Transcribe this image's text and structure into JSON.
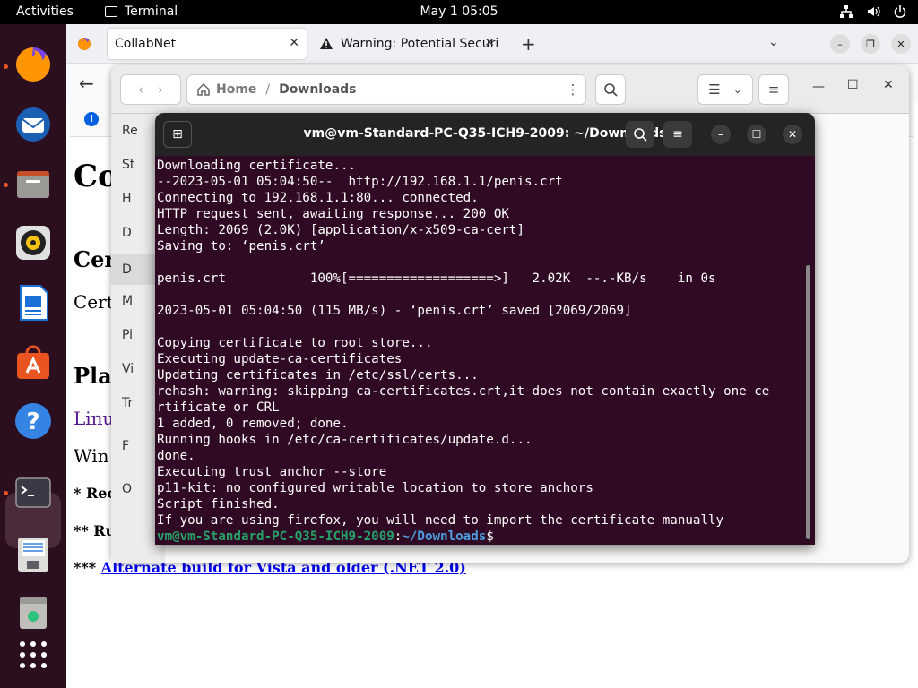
{
  "topbar": {
    "activities": "Activities",
    "app": "Terminal",
    "clock": "May 1  05:05",
    "icons": [
      "network-icon",
      "volume-icon",
      "power-icon"
    ]
  },
  "dock": {
    "apps": [
      "firefox-icon",
      "thunderbird-icon",
      "files-icon",
      "rhythmbox-icon",
      "writer-icon",
      "app-center-icon",
      "help-icon",
      "terminal-icon",
      "text-editor-icon",
      "trash-icon",
      "show-apps-icon"
    ]
  },
  "browser": {
    "tabs": [
      {
        "label": "CollabNet"
      },
      {
        "label": "Warning: Potential Securi"
      }
    ],
    "page": {
      "heading1": "Co",
      "heading2": "Cer",
      "link1": "Cert",
      "heading3": "Pla",
      "link2": "Linu",
      "link3": "Win",
      "note1": "* Rec",
      "note2": "** Ru",
      "note3_prefix": "*** ",
      "note3_link": "Alternate build for Vista and older (.NET 2.0)"
    }
  },
  "files": {
    "breadcrumb": {
      "home": "Home",
      "separator": "/",
      "current": "Downloads"
    },
    "sidebar": [
      "Re",
      "St",
      "H",
      "D",
      "D",
      "M",
      "Pi",
      "Vi",
      "Tr",
      "F",
      "O"
    ]
  },
  "terminal": {
    "title": "vm@vm-Standard-PC-Q35-ICH9-2009: ~/Downloads",
    "lines": [
      "Downloading certificate...",
      "--2023-05-01 05:04:50--  http://192.168.1.1/penis.crt",
      "Connecting to 192.168.1.1:80... connected.",
      "HTTP request sent, awaiting response... 200 OK",
      "Length: 2069 (2.0K) [application/x-x509-ca-cert]",
      "Saving to: ‘penis.crt’",
      "",
      "penis.crt           100%[===================>]   2.02K  --.-KB/s    in 0s",
      "",
      "2023-05-01 05:04:50 (115 MB/s) - ‘penis.crt’ saved [2069/2069]",
      "",
      "Copying certificate to root store...",
      "Executing update-ca-certificates",
      "Updating certificates in /etc/ssl/certs...",
      "rehash: warning: skipping ca-certificates.crt,it does not contain exactly one ce",
      "rtificate or CRL",
      "1 added, 0 removed; done.",
      "Running hooks in /etc/ca-certificates/update.d...",
      "done.",
      "Executing trust anchor --store",
      "p11-kit: no configured writable location to store anchors",
      "Script finished.",
      "If you are using firefox, you will need to import the certificate manually"
    ],
    "prompt_user": "vm@vm-Standard-PC-Q35-ICH9-2009",
    "prompt_sep": ":",
    "prompt_path": "~/Downloads",
    "prompt_end": "$"
  },
  "colors": {
    "terminal_bg": "#300a24",
    "dock_bg": "#2c0f1f",
    "prompt_user": "#26a269",
    "prompt_path": "#4c9fe0"
  }
}
